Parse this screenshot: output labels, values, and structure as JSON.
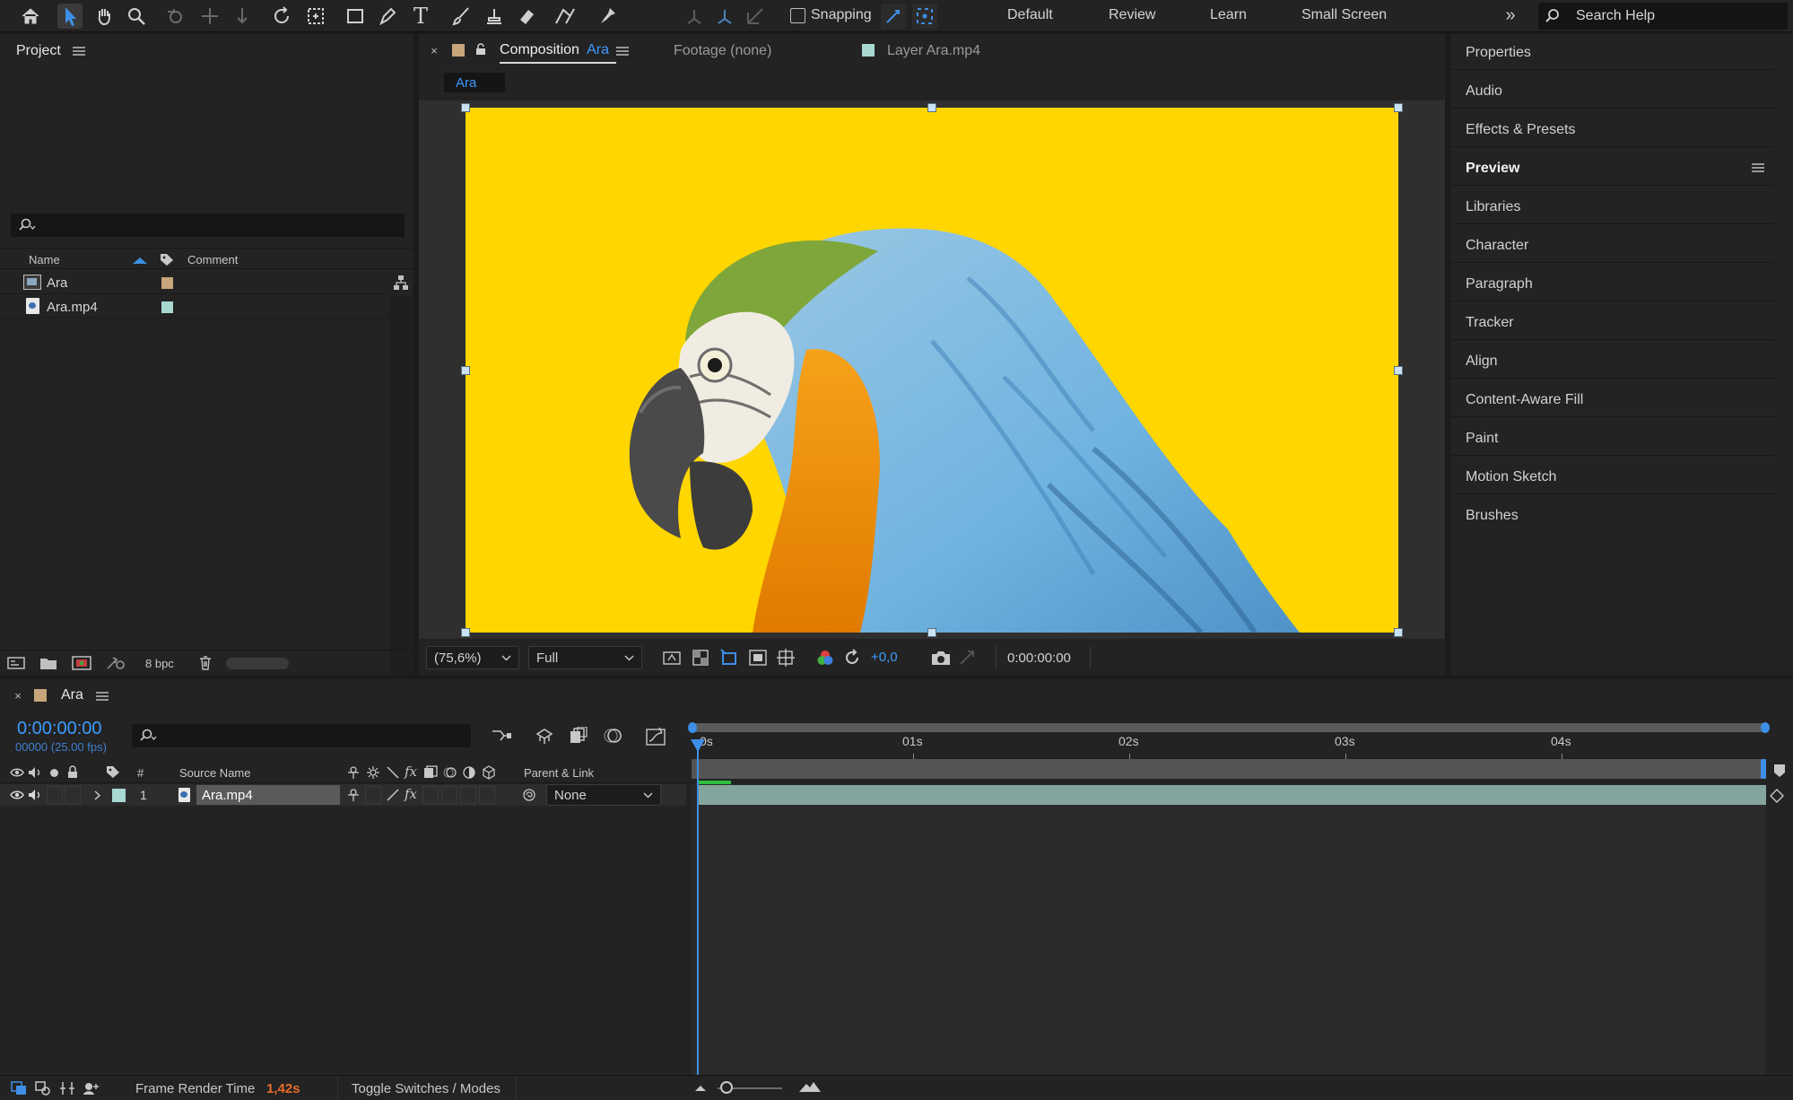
{
  "toolbar": {
    "snapping_label": "Snapping",
    "workspaces": [
      "Default",
      "Review",
      "Learn",
      "Small Screen"
    ],
    "search_placeholder": "Search Help"
  },
  "project": {
    "title": "Project",
    "columns": {
      "name": "Name",
      "comment": "Comment"
    },
    "items": [
      {
        "name": "Ara",
        "type": "composition",
        "label_color": "#c8a57a"
      },
      {
        "name": "Ara.mp4",
        "type": "footage",
        "label_color": "#a8d8d2"
      }
    ],
    "bpc_label": "8 bpc"
  },
  "viewer": {
    "tabs": {
      "composition_prefix": "Composition",
      "composition_name": "Ara",
      "footage": "Footage (none)",
      "layer": "Layer Ara.mp4"
    },
    "breadcrumb": "Ara",
    "zoom": "(75,6%)",
    "resolution": "Full",
    "exposure": "+0,0",
    "timecode": "0:00:00:00",
    "canvas_color": "#ffd600"
  },
  "right_panels": [
    "Properties",
    "Audio",
    "Effects & Presets",
    "Preview",
    "Libraries",
    "Character",
    "Paragraph",
    "Tracker",
    "Align",
    "Content-Aware Fill",
    "Paint",
    "Motion Sketch",
    "Brushes"
  ],
  "timeline": {
    "comp_name": "Ara",
    "timecode": "0:00:00:00",
    "frames_fps": "00000 (25.00 fps)",
    "columns": {
      "number": "#",
      "source": "Source Name",
      "parent": "Parent & Link"
    },
    "layer": {
      "index": "1",
      "name": "Ara.mp4",
      "parent": "None"
    },
    "ruler": [
      "0s",
      "01s",
      "02s",
      "03s",
      "04s"
    ]
  },
  "status": {
    "render_label": "Frame Render Time",
    "render_value": "1,42s",
    "toggle_label": "Toggle Switches / Modes"
  },
  "colors": {
    "accent": "#2d8ceb",
    "layer_bar": "#a3cfc4",
    "render_value": "#e86c2a"
  }
}
